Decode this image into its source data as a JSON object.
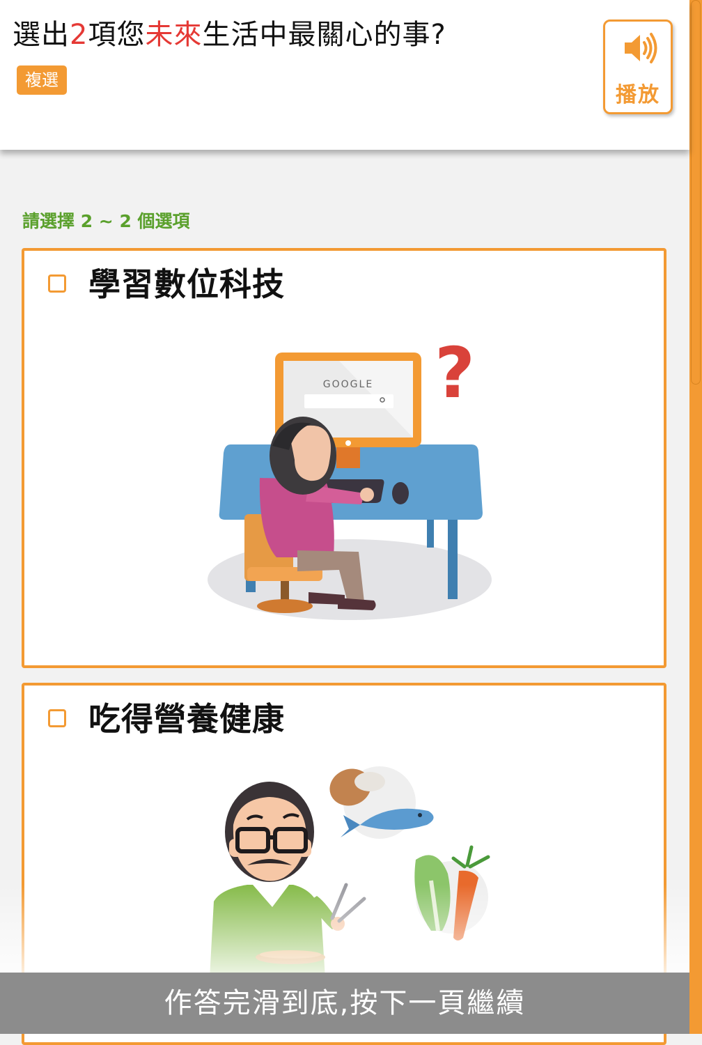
{
  "question": {
    "prefix": "選出",
    "count": "2",
    "middle": "項您",
    "highlight": "未來",
    "suffix": "生活中最關心的事?"
  },
  "badge": "複選",
  "play_button": {
    "label": "播放",
    "icon": "speaker-icon"
  },
  "hint": "請選擇 2 ~ 2 個選項",
  "options": [
    {
      "label": "學習數位科技",
      "checked": false,
      "image": "elderly-woman-computer-illustration"
    },
    {
      "label": "吃得營養健康",
      "checked": false,
      "image": "elderly-man-healthy-food-illustration"
    }
  ],
  "footer": "作答完滑到底,按下一頁繼續",
  "colors": {
    "accent": "#f39a33",
    "highlight": "#e53935",
    "hint": "#5aa02c",
    "footer_bg": "#8c8c8c"
  }
}
